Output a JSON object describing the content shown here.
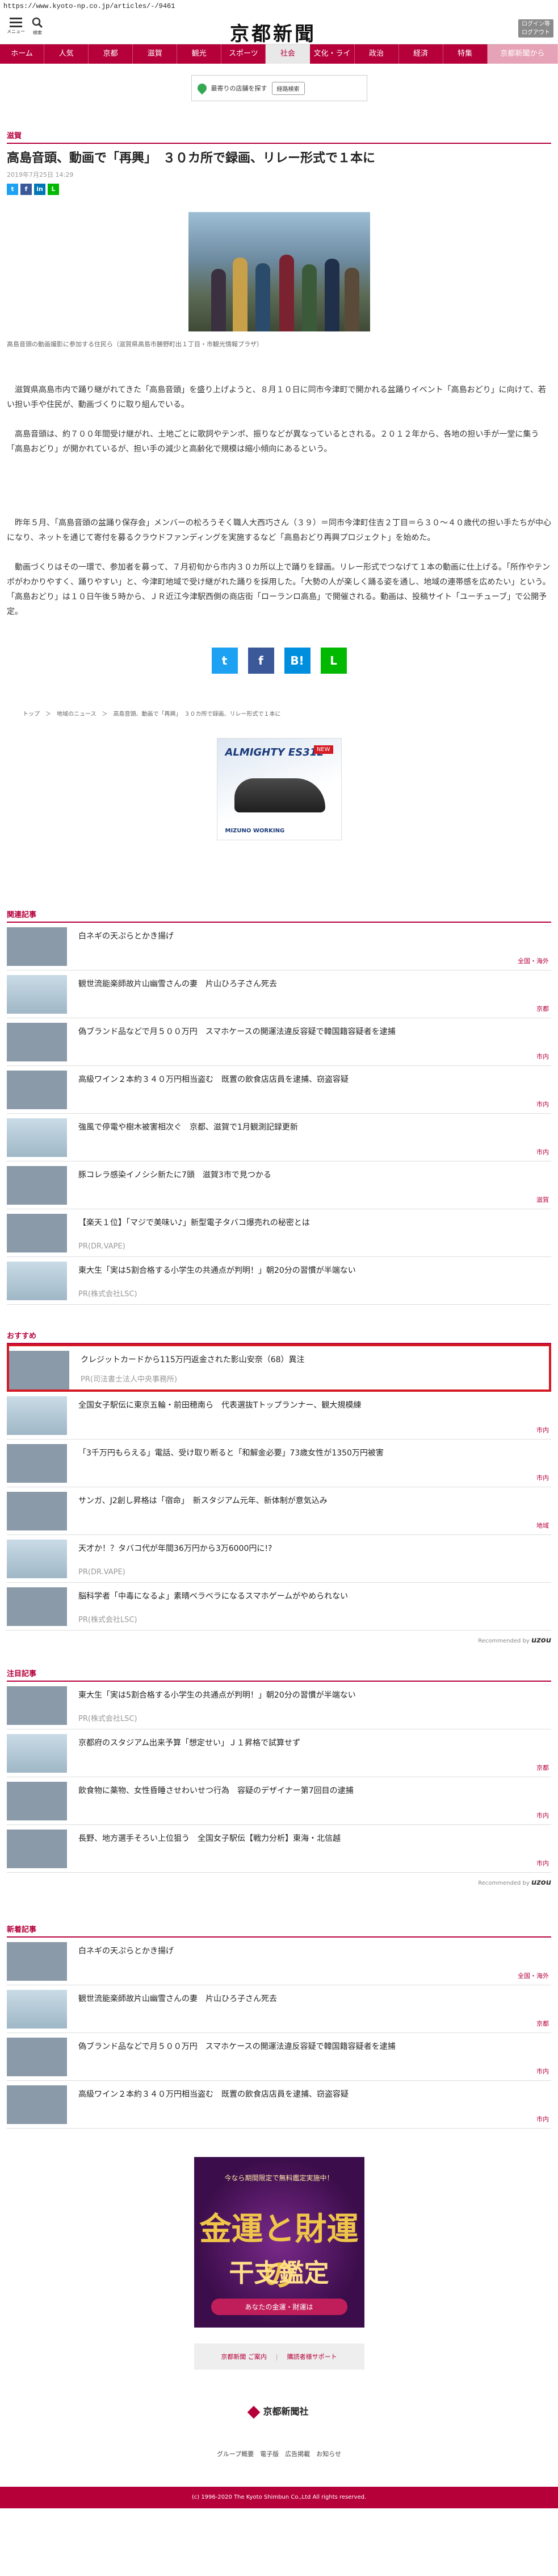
{
  "url": "https://www.kyoto-np.co.jp/articles/-/9461",
  "header": {
    "menu_label": "メニュー",
    "search_label": "検索",
    "logo": "京都新聞",
    "login_line1": "ログイン等",
    "login_line2": "ログアウト"
  },
  "nav": [
    "ホーム",
    "人気",
    "京都",
    "滋賀",
    "観光",
    "スポーツ",
    "社会",
    "文化・ライフ",
    "政治",
    "経済",
    "特集",
    "京都新聞から"
  ],
  "nav_active": "社会",
  "map_ad": {
    "text": "最寄りの店舗を探す",
    "button": "経路検索"
  },
  "article": {
    "category": "滋賀",
    "headline": "高島音頭、動画で「再興」　３０カ所で録画、リレー形式で１本に",
    "date": "2019年7月25日 14:29",
    "caption": "高島音頭の動画撮影に参加する住民ら（滋賀県高島市勝野町出１丁目・市観光情報プラザ）",
    "paragraphs": [
      "滋賀県高島市内で踊り継がれてきた「高島音頭」を盛り上げようと、８月１０日に同市今津町で開かれる盆踊りイベント「高島おどり」に向けて、若い担い手や住民が、動画づくりに取り組んでいる。",
      "高島音頭は、約７００年間受け継がれ、土地ごとに歌詞やテンポ、振りなどが異なっているとされる。２０１２年から、各地の担い手が一堂に集う「高島おどり」が開かれているが、担い手の減少と高齢化で規模は縮小傾向にあるという。",
      "昨年５月、「高島音頭の盆踊り保存会」メンバーの松ろうそく職人大西巧さん（３９）＝同市今津町住吉２丁目＝ら３０～４０歳代の担い手たちが中心になり、ネットを通じて寄付を募るクラウドファンディングを実施するなど「高島おどり再興プロジェクト」を始めた。",
      "動画づくりはその一環で、参加者を募って、７月初旬から市内３０カ所以上で踊りを録画。リレー形式でつなげて１本の動画に仕上げる。「所作やテンポがわかりやすく、踊りやすい」と、今津町地域で受け継がれた踊りを採用した。「大勢の人が楽しく踊る姿を通し、地域の連帯感を広めたい」という。「高島おどり」は１０日午後５時から、ＪＲ近江今津駅西側の商店街「ローランロ高島」で開催される。動画は、投稿サイト「ユーチューブ」で公開予定。"
    ],
    "breadcrumb": "トップ　＞　地域のニュース　＞　高島音頭、動画で「再興」　３０カ所で録画、リレー形式で１本に"
  },
  "shoe_ad": {
    "brand": "ALMIGHTY ES31L",
    "maker": "MIZUNO WORKING",
    "badge": "NEW"
  },
  "related": {
    "heading": "関連記事",
    "items": [
      {
        "title": "白ネギの天ぷらとかき揚げ",
        "cat": "全国・海外",
        "src": ""
      },
      {
        "title": "観世流能楽師故片山幽雪さんの妻　片山ひろ子さん死去",
        "cat": "京都",
        "src": ""
      },
      {
        "title": "偽ブランド品などで月５００万円　スマホケースの開運法違反容疑で韓国籍容疑者を逮捕",
        "cat": "市内",
        "src": ""
      },
      {
        "title": "高級ワイン２本約３４０万円相当盗む　既置の飲食店店員を逮捕、窃盗容疑",
        "cat": "市内",
        "src": ""
      },
      {
        "title": "強風で停電や樹木被害相次ぐ　京都、滋賀で1月観測記録更新",
        "cat": "市内",
        "src": ""
      },
      {
        "title": "豚コレラ感染イノシシ新たに7頭　滋賀3市で見つかる",
        "cat": "滋賀",
        "src": ""
      },
      {
        "title": "【楽天１位】「マジで美味い♪」新型電子タバコ爆売れの秘密とは",
        "cat": "",
        "src": "PR(DR.VAPE)"
      },
      {
        "title": "東大生「実は5割合格する小学生の共通点が判明！」朝20分の習慣が半端ない",
        "cat": "",
        "src": "PR(株式会社LSC)"
      }
    ]
  },
  "recommend": {
    "heading": "おすすめ",
    "items": [
      {
        "title": "クレジットカードから115万円返金された影山安奈（68）異注",
        "cat": "",
        "src": "PR(司法書士法人中央事務所)"
      },
      {
        "title": "全国女子駅伝に東京五輪・前田穂南ら　代表選抜Tトップランナー、観大規模練",
        "cat": "市内",
        "src": ""
      },
      {
        "title": "「3千万円もらえる」電話、受け取り断ると「和解金必要」73歳女性が1350万円被害",
        "cat": "市内",
        "src": ""
      },
      {
        "title": "サンガ、J2創し昇格は「宿命」　新スタジアム元年、新体制が意気込み",
        "cat": "地域",
        "src": ""
      },
      {
        "title": "天才か！？タバコ代が年間36万円から3万6000円に!?",
        "cat": "",
        "src": "PR(DR.VAPE)"
      },
      {
        "title": "脳科学者「中毒になるよ」素晴ベラベラになるスマホゲームがやめられない",
        "cat": "",
        "src": "PR(株式会社LSC)"
      }
    ],
    "by": "Recommended by",
    "by_brand": "uzou"
  },
  "attention": {
    "heading": "注目記事",
    "items": [
      {
        "title": "東大生「実は5割合格する小学生の共通点が判明！」朝20分の習慣が半端ない",
        "cat": "",
        "src": "PR(株式会社LSC)"
      },
      {
        "title": "京都府のスタジアム出来予算「想定せい」Ｊ１昇格で試算せず",
        "cat": "京都",
        "src": ""
      },
      {
        "title": "飲食物に薬物、女性昏睡させわいせつ行為　容疑のデザイナー第7回目の逮捕",
        "cat": "市内",
        "src": ""
      },
      {
        "title": "長野、地方選手そろい上位狙う　全国女子駅伝【戦力分析】東海・北信越",
        "cat": "市内",
        "src": ""
      }
    ],
    "by": "Recommended by",
    "by_brand": "uzou"
  },
  "newest": {
    "heading": "新着記事",
    "items": [
      {
        "title": "白ネギの天ぷらとかき揚げ",
        "cat": "全国・海外",
        "src": ""
      },
      {
        "title": "観世流能楽師故片山幽雪さんの妻　片山ひろ子さん死去",
        "cat": "京都",
        "src": ""
      },
      {
        "title": "偽ブランド品などで月５００万円　スマホケースの開運法違反容疑で韓国籍容疑者を逮捕",
        "cat": "市内",
        "src": ""
      },
      {
        "title": "高級ワイン２本約３４０万円相当盗む　既置の飲食店店員を逮捕、窃盗容疑",
        "cat": "市内",
        "src": ""
      }
    ]
  },
  "kanji_ad": {
    "top": "今なら期間限定で無料鑑定実施中！",
    "line1": "金運と財運の",
    "line2": "干支鑑定",
    "cta": "あなたの金運・財運は"
  },
  "footer": {
    "links": [
      "京都新聞 ご案内",
      "購読者様サポート"
    ],
    "brand": "京都新聞社",
    "nav": "グループ概要　電子版　広告掲載　お知らせ",
    "copyright": "(c) 1996-2020 The Kyoto Shimbun Co.,Ltd All rights reserved."
  },
  "colors": {
    "brand": "#b6003a",
    "highlight": "#d51a24",
    "twitter": "#1da1f2",
    "facebook": "#3b5998",
    "hatena": "#008fde",
    "line": "#00b900"
  }
}
